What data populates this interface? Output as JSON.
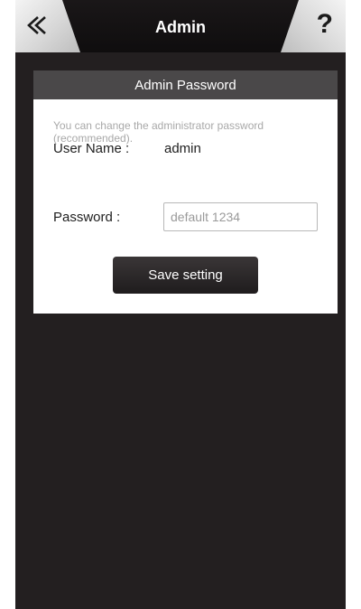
{
  "header": {
    "title": "Admin",
    "back_icon": "double-chevron-left-icon",
    "help_label": "?"
  },
  "admin_password": {
    "section_title": "Admin Password",
    "hint": "You can change the administrator password (recommended).",
    "username_label": "User Name :",
    "username_value": "admin",
    "password_label": "Password :",
    "password_value": "",
    "password_placeholder": "default 1234",
    "save_label": "Save setting"
  },
  "colors": {
    "background": "#231f20",
    "section_header": "#4a4849",
    "hint_text": "#a8a8a8"
  }
}
